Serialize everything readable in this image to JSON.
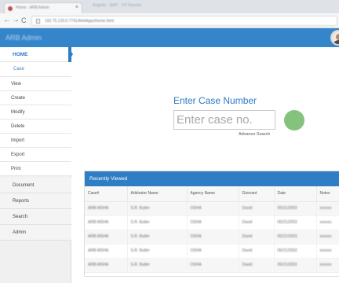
{
  "browser": {
    "tab_title": "Home - ARB Admin",
    "tab_close": "×",
    "second_tab": "Angular · MAP · FH Reports",
    "url": "192.75.129.5:7741/ArbiApps/home.html",
    "back": "←",
    "forward": "→",
    "reload": "C"
  },
  "header": {
    "brand": "ARB Admin"
  },
  "sidebar": {
    "home_label": "HOME",
    "case_label": "Case",
    "case_items": [
      "View",
      "Create",
      "Modify",
      "Delete",
      "Import",
      "Export",
      "Print"
    ],
    "main_items": [
      "Document",
      "Reports",
      "Search",
      "Admin"
    ]
  },
  "case_search": {
    "title": "Enter Case Number",
    "placeholder": "Enter case no.",
    "advanced_link": "Advance Search"
  },
  "recent": {
    "title": "Recently Viewed",
    "columns": [
      "Case#",
      "Arbitrator Name",
      "Agency Name",
      "Grievant",
      "Date",
      "Notes"
    ],
    "rows": [
      [
        "ARB-MSHA",
        "S.R. Butler",
        "OSHA",
        "David",
        "05/21/2003",
        "xxxxxx"
      ],
      [
        "ARB-MSHA",
        "S.R. Butler",
        "OSHA",
        "David",
        "05/21/2003",
        "xxxxxx"
      ],
      [
        "ARB-MSHA",
        "S.R. Butler",
        "OSHA",
        "David",
        "05/21/2003",
        "xxxxxx"
      ],
      [
        "ARB-MSHA",
        "S.R. Butler",
        "OSHA",
        "David",
        "05/21/2003",
        "xxxxxx"
      ],
      [
        "ARB-MSHA",
        "S.R. Butler",
        "OSHA",
        "David",
        "05/21/2003",
        "xxxxxx"
      ]
    ]
  },
  "colors": {
    "brand_blue": "#2f7dc4",
    "go_button": "#85c27e"
  }
}
